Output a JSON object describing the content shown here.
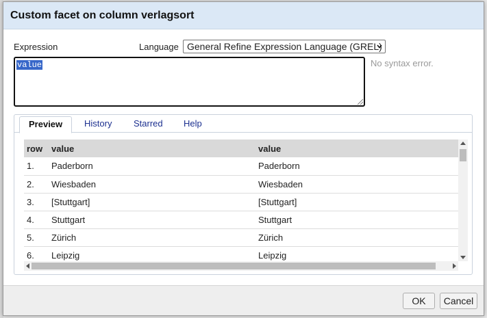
{
  "dialog": {
    "title": "Custom facet on column verlagsort"
  },
  "expression": {
    "label": "Expression",
    "value": "value",
    "status": "No syntax error."
  },
  "language": {
    "label": "Language",
    "selected": "General Refine Expression Language (GREL)"
  },
  "tabs": [
    {
      "label": "Preview"
    },
    {
      "label": "History"
    },
    {
      "label": "Starred"
    },
    {
      "label": "Help"
    }
  ],
  "preview": {
    "headers": {
      "row": "row",
      "value": "value",
      "result": "value"
    },
    "rows": [
      {
        "n": "1.",
        "value": "Paderborn",
        "result": "Paderborn"
      },
      {
        "n": "2.",
        "value": "Wiesbaden",
        "result": "Wiesbaden"
      },
      {
        "n": "3.",
        "value": "[Stuttgart]",
        "result": "[Stuttgart]"
      },
      {
        "n": "4.",
        "value": "Stuttgart",
        "result": "Stuttgart"
      },
      {
        "n": "5.",
        "value": "Zürich",
        "result": "Zürich"
      },
      {
        "n": "6.",
        "value": "Leipzig",
        "result": "Leipzig"
      }
    ]
  },
  "footer": {
    "ok_label": "OK",
    "cancel_label": "Cancel"
  }
}
